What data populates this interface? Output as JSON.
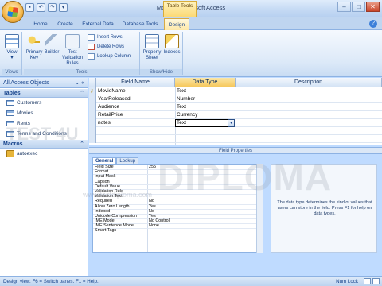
{
  "window": {
    "title": "Movies : Microsoft Access",
    "contextual_tab_group": "Table Tools",
    "controls": [
      "–",
      "□",
      "✕"
    ]
  },
  "qat": [
    "save",
    "undo",
    "redo",
    "customize"
  ],
  "ribbon_tabs": [
    "Home",
    "Create",
    "External Data",
    "Database Tools",
    "Design"
  ],
  "active_tab": "Design",
  "ribbon": {
    "views": {
      "label": "Views",
      "view_btn": "View"
    },
    "tools": {
      "label": "Tools",
      "primary_key": "Primary Key",
      "builder": "Builder",
      "test_validation": "Test Validation Rules",
      "insert_rows": "Insert Rows",
      "delete_rows": "Delete Rows",
      "lookup_column": "Lookup Column"
    },
    "show_hide": {
      "label": "Show/Hide",
      "property_sheet": "Property Sheet",
      "indexes": "Indexes"
    }
  },
  "nav": {
    "header": "All Access Objects",
    "sections": [
      {
        "title": "Tables",
        "items": [
          "Customers",
          "Movies",
          "Rents",
          "Terms and Conditions"
        ]
      },
      {
        "title": "Macros",
        "items": [
          "autoexec"
        ]
      }
    ]
  },
  "grid": {
    "headers": [
      "Field Name",
      "Data Type",
      "Description"
    ],
    "rows": [
      {
        "field": "MovieName",
        "type": "Text",
        "key": true
      },
      {
        "field": "YearReleased",
        "type": "Number",
        "key": false
      },
      {
        "field": "Audience",
        "type": "Text",
        "key": false
      },
      {
        "field": "RetailPrice",
        "type": "Currency",
        "key": false
      },
      {
        "field": "notes",
        "type": "Text",
        "key": false
      }
    ]
  },
  "field_properties": {
    "title": "Field Properties",
    "tabs": [
      "General",
      "Lookup"
    ],
    "active_tab": "General",
    "rows": [
      [
        "Field Size",
        "255"
      ],
      [
        "Format",
        ""
      ],
      [
        "Input Mask",
        ""
      ],
      [
        "Caption",
        ""
      ],
      [
        "Default Value",
        ""
      ],
      [
        "Validation Rule",
        ""
      ],
      [
        "Validation Text",
        ""
      ],
      [
        "Required",
        "No"
      ],
      [
        "Allow Zero Length",
        "Yes"
      ],
      [
        "Indexed",
        "No"
      ],
      [
        "Unicode Compression",
        "Yes"
      ],
      [
        "IME Mode",
        "No Control"
      ],
      [
        "IME Sentence Mode",
        "None"
      ],
      [
        "Smart Tags",
        ""
      ]
    ],
    "help": "The data type determines the kind of values that users can store in the field. Press F1 for help on data types."
  },
  "status": {
    "left": "Design view.  F6 = Switch panes.  F1 = Help.",
    "right": "Num Lock"
  },
  "watermark": {
    "brand": "TEST 4U",
    "diploma": "DIPLOMA",
    "site": "www.testdiploma.com"
  },
  "colors": {
    "accent": "#15428b",
    "active_tab": "#fde8a8",
    "ribbon": "#dce9f8"
  }
}
